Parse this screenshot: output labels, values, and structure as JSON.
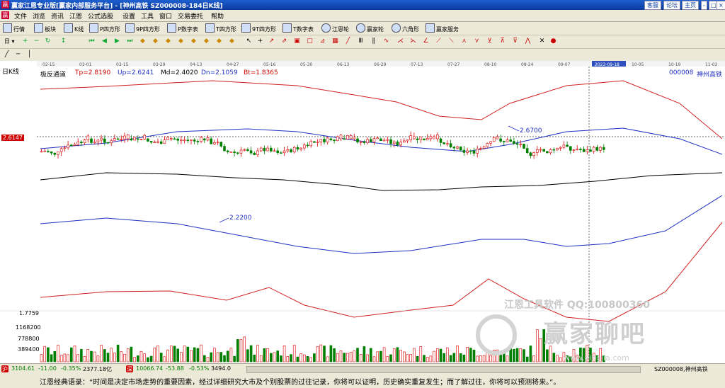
{
  "window": {
    "title": "赢家江恩专业版[赢家内部服务平台] - [神州高铁   SZ000008-184日K线]",
    "right_buttons": [
      "客服",
      "论坛",
      "主页"
    ],
    "ctrl_buttons": [
      "-",
      "□",
      "×"
    ]
  },
  "menu": [
    "文件",
    "浏览",
    "资讯",
    "江恩",
    "公式选股",
    "设置",
    "工具",
    "窗口",
    "交易委托",
    "帮助"
  ],
  "toolbar1": [
    "行情",
    "板块",
    "K线",
    "P四方形",
    "9P四方形",
    "P数字表",
    "T四方形",
    "9T四方形",
    "T数字表",
    "江恩轮",
    "赢家轮",
    "六角形",
    "赢家服务"
  ],
  "toolbar2_label": "日",
  "chart": {
    "period_label": "日K线",
    "indicator_name": "极反通道",
    "tp": "Tp=2.8190",
    "up": "Up=2.6241",
    "md": "Md=2.4020",
    "dn": "Dn=2.1059",
    "bt": "Bt=1.8365",
    "stock_code": "000008",
    "stock_name": "神州高铁",
    "dates": [
      "02-15",
      "03-01",
      "03-15",
      "03-29",
      "04-13",
      "04-27",
      "05-16",
      "05-30",
      "06-13",
      "06-29",
      "07-13",
      "07-27",
      "08-10",
      "08-24",
      "09-07",
      "2023-09-18",
      "10-05",
      "10-19",
      "11-02"
    ],
    "crosshair_price": "2.6147",
    "high_label": "2.6700",
    "low_label": "2.2200",
    "volume_axis": [
      "1.7759",
      "1168200",
      "778800",
      "389400"
    ],
    "watermark_text": "江恩工具软件  QQ:100800360",
    "watermark_logo": "赢家聊吧",
    "watermark_url": "www.yingjia.com",
    "colors": {
      "up": "#d90000",
      "down": "#007f00",
      "channel_outer": "#d02020",
      "channel_inner": "#2030c0",
      "ma": "#000000"
    }
  },
  "status": {
    "sh_index": "3104.61",
    "sh_change": "-11.00",
    "sh_pct": "-0.35%",
    "sh_amount": "2377.18亿",
    "sz_index": "10066.74",
    "sz_change": "-53.88",
    "sz_pct": "-0.53%",
    "sz_amount": "3494.0",
    "right": "SZ000008,神州高铁"
  },
  "quote": "江恩经典语录：“时间是决定市场走势的重要因素，经过详细研究大市及个别股票的过往记录，你将可以证明，历史确实重复发生；而了解过往，你将可以预测将来。”。"
}
